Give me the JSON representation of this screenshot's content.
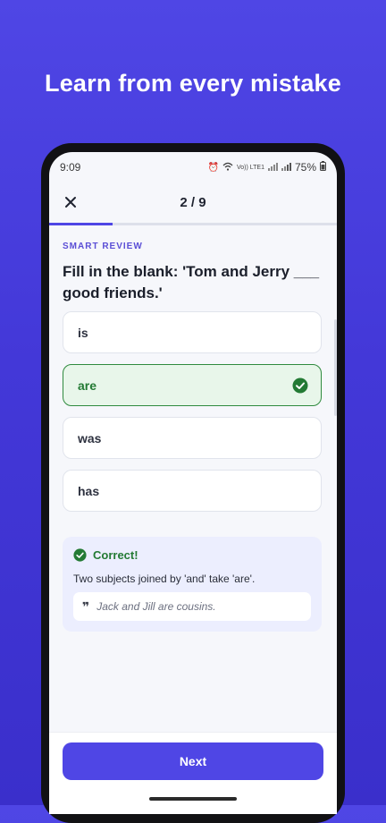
{
  "promo": {
    "headline": "Learn from every mistake"
  },
  "status_bar": {
    "time": "9:09",
    "network": "Vo)) LTE1",
    "battery": "75%"
  },
  "quiz": {
    "progress_label": "2 / 9",
    "progress_fraction": 0.22,
    "section_label": "SMART REVIEW",
    "question": "Fill in the blank: 'Tom and Jerry ___ good friends.'",
    "options": [
      {
        "label": "is",
        "state": "default"
      },
      {
        "label": "are",
        "state": "correct"
      },
      {
        "label": "was",
        "state": "default"
      },
      {
        "label": "has",
        "state": "default"
      }
    ]
  },
  "feedback": {
    "title": "Correct!",
    "explanation": "Two subjects joined by 'and' take 'are'.",
    "example": "Jack and Jill are cousins."
  },
  "actions": {
    "next_label": "Next"
  },
  "colors": {
    "accent": "#4f46e5",
    "success": "#237a34",
    "success_bg": "#e8f6ea"
  }
}
